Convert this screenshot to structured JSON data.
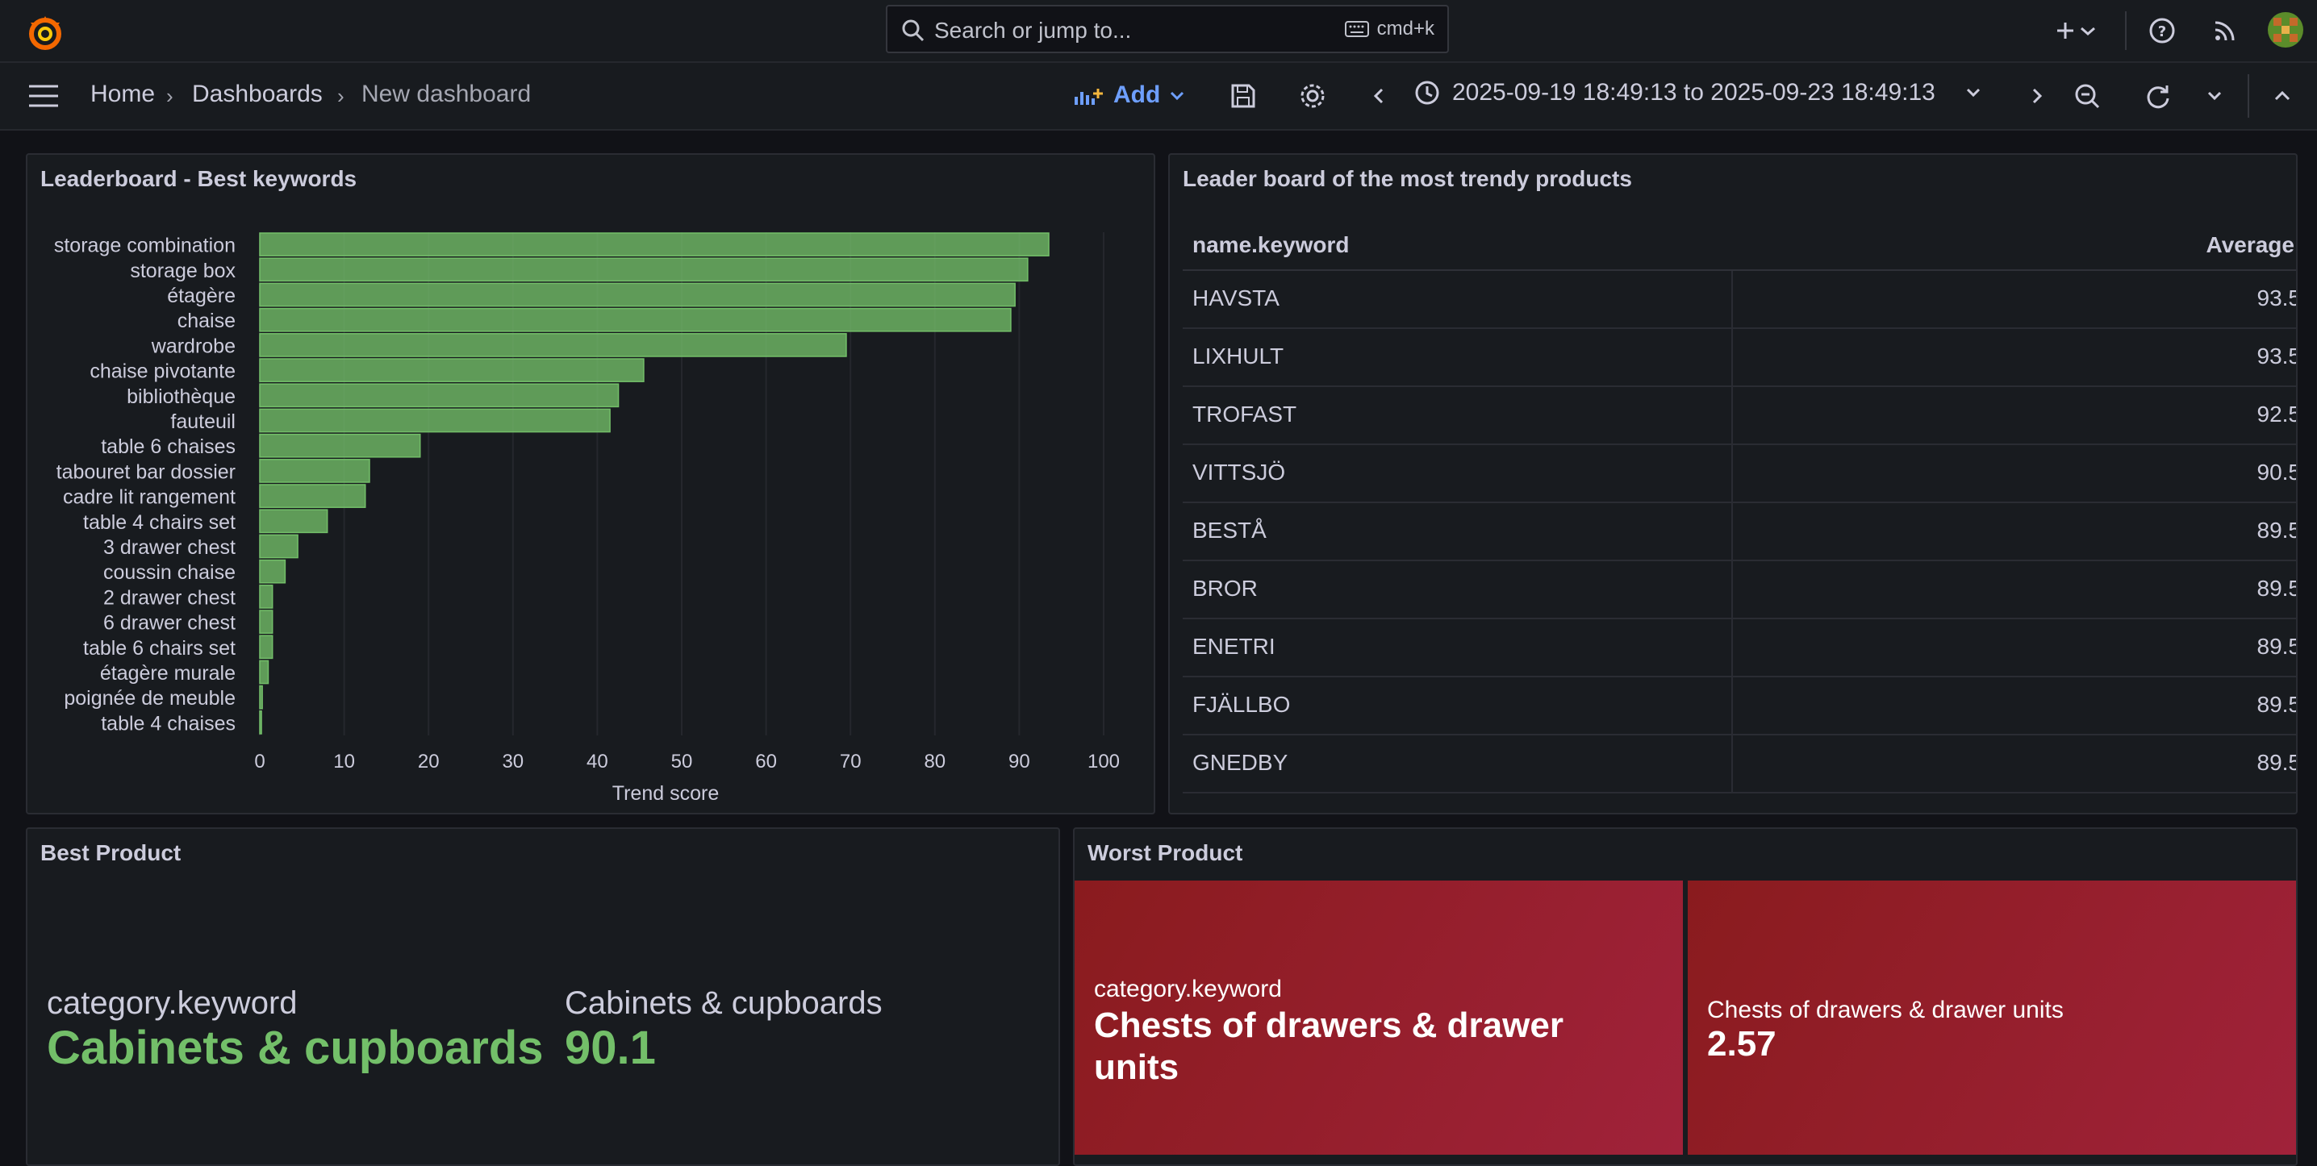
{
  "topbar": {
    "search_placeholder": "Search or jump to...",
    "search_shortcut": "cmd+k"
  },
  "breadcrumb": {
    "home": "Home",
    "dashboards": "Dashboards",
    "current": "New dashboard"
  },
  "toolbar": {
    "add_label": "Add",
    "time_range": "2025-09-19 18:49:13 to 2025-09-23 18:49:13"
  },
  "panels": {
    "keywords": {
      "title": "Leaderboard - Best keywords"
    },
    "products": {
      "title": "Leader board of the most trendy products",
      "columns": [
        "name.keyword",
        "Average"
      ],
      "rows": [
        {
          "name": "HAVSTA",
          "value": "93.5"
        },
        {
          "name": "LIXHULT",
          "value": "93.5"
        },
        {
          "name": "TROFAST",
          "value": "92.5"
        },
        {
          "name": "VITTSJÖ",
          "value": "90.5"
        },
        {
          "name": "BESTÅ",
          "value": "89.5"
        },
        {
          "name": "BROR",
          "value": "89.5"
        },
        {
          "name": "ENETRI",
          "value": "89.5"
        },
        {
          "name": "FJÄLLBO",
          "value": "89.5"
        },
        {
          "name": "GNEDBY",
          "value": "89.5"
        }
      ]
    },
    "best": {
      "title": "Best Product",
      "label1": "category.keyword",
      "value1": "Cabinets & cupboards",
      "label2": "Cabinets & cupboards",
      "value2": "90.1"
    },
    "worst": {
      "title": "Worst Product",
      "label1": "category.keyword",
      "value1": "Chests of drawers & drawer units",
      "label2": "Chests of drawers & drawer units",
      "value2": "2.57"
    }
  },
  "colors": {
    "bar": "#73bf69",
    "stat_green": "#73bf69",
    "worst_red": "#a0223a",
    "accent_blue": "#6e9fff"
  },
  "chart_data": {
    "type": "bar",
    "orientation": "horizontal",
    "title": "Leaderboard - Best keywords",
    "xlabel": "Trend score",
    "xlim": [
      0,
      100
    ],
    "xticks": [
      0,
      10,
      20,
      30,
      40,
      50,
      60,
      70,
      80,
      90,
      100
    ],
    "categories": [
      "storage combination",
      "storage box",
      "étagère",
      "chaise",
      "wardrobe",
      "chaise pivotante",
      "bibliothèque",
      "fauteuil",
      "table 6 chaises",
      "tabouret bar dossier",
      "cadre lit rangement",
      "table 4 chairs set",
      "3 drawer chest",
      "coussin chaise",
      "2 drawer chest",
      "6 drawer chest",
      "table 6 chairs set",
      "étagère murale",
      "poignée de meuble",
      "table 4 chaises"
    ],
    "values": [
      93.5,
      91,
      89.5,
      89,
      69.5,
      45.5,
      42.5,
      41.5,
      19,
      13,
      12.5,
      8,
      4.5,
      3,
      1.5,
      1.5,
      1.5,
      1,
      0.3,
      0.2
    ],
    "grid": true
  }
}
